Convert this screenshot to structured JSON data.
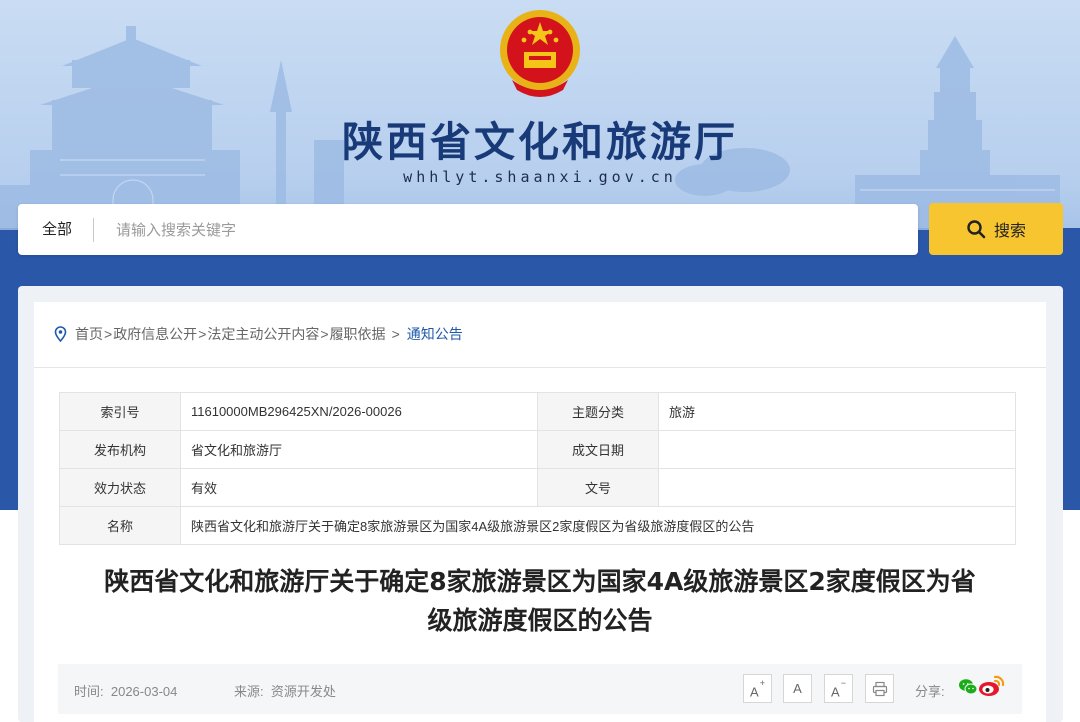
{
  "header": {
    "site_title": "陕西省文化和旅游厅",
    "site_url": "whhlyt.shaanxi.gov.cn"
  },
  "search": {
    "scope": "全部",
    "placeholder": "请输入搜索关键字",
    "button_label": "搜索"
  },
  "breadcrumb": {
    "items": [
      "首页",
      "政府信息公开",
      "法定主动公开内容",
      "履职依据"
    ],
    "current": "通知公告"
  },
  "meta": {
    "index_label": "索引号",
    "index_value": "11610000MB296425XN/2026-00026",
    "topic_label": "主题分类",
    "topic_value": "旅游",
    "publisher_label": "发布机构",
    "publisher_value": "省文化和旅游厅",
    "date_label": "成文日期",
    "date_value": "",
    "status_label": "效力状态",
    "status_value": "有效",
    "docno_label": "文号",
    "docno_value": "",
    "name_label": "名称",
    "name_value": "陕西省文化和旅游厅关于确定8家旅游景区为国家4A级旅游景区2家度假区为省级旅游度假区的公告"
  },
  "article": {
    "title_line1": "陕西省文化和旅游厅关于确定8家旅游景区为国家4A级旅游景区2家度假区为省",
    "title_line2": "级旅游度假区的公告",
    "time_label": "时间:",
    "time_value": "2026-03-04",
    "source_label": "来源:",
    "source_value": "资源开发处",
    "font_increase": "A",
    "font_reset": "A",
    "font_decrease": "A",
    "increase_sup": "+",
    "decrease_sup": "−",
    "share_label": "分享:"
  },
  "colors": {
    "banner_blue": "#2a57a8",
    "title_blue": "#183a78",
    "search_button": "#f7c530",
    "breadcrumb_current": "#1f5aa8"
  },
  "icons": [
    "national-emblem-icon",
    "search-icon",
    "location-pin-icon",
    "print-icon",
    "wechat-icon",
    "weibo-icon"
  ]
}
